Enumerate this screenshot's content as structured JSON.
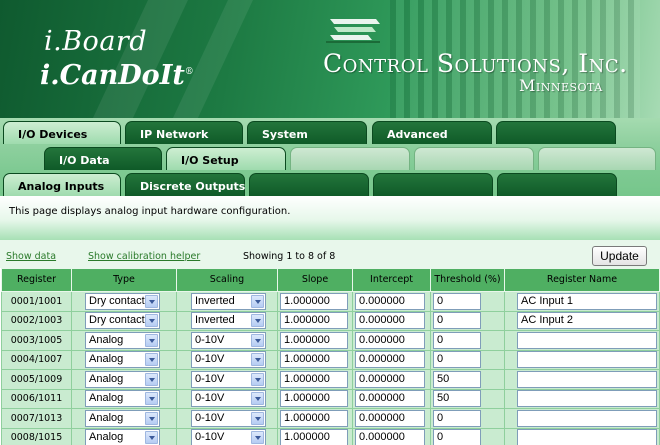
{
  "brand": {
    "line1": "i.Board",
    "line2": "i.CanDoIt",
    "trademark": "®",
    "company": "Control Solutions, Inc.",
    "state": "Minnesota"
  },
  "tabs_level1": [
    "I/O Devices",
    "IP Network",
    "System",
    "Advanced"
  ],
  "tabs_level2": [
    "I/O Data",
    "I/O Setup"
  ],
  "tabs_level3": [
    "Analog Inputs",
    "Discrete Outputs"
  ],
  "description": "This page displays analog input hardware configuration.",
  "toolbar": {
    "show_data": "Show data",
    "show_calibration": "Show calibration helper",
    "showing": "Showing 1 to 8 of 8",
    "update": "Update"
  },
  "table": {
    "headers": [
      "Register",
      "Type",
      "Scaling",
      "Slope",
      "Intercept",
      "Threshold (%)",
      "Register Name"
    ],
    "rows": [
      {
        "register": "0001/1001",
        "type": "Dry contact",
        "scaling": "Inverted",
        "slope": "1.000000",
        "intercept": "0.000000",
        "threshold": "0",
        "name": "AC Input 1"
      },
      {
        "register": "0002/1003",
        "type": "Dry contact",
        "scaling": "Inverted",
        "slope": "1.000000",
        "intercept": "0.000000",
        "threshold": "0",
        "name": "AC Input 2"
      },
      {
        "register": "0003/1005",
        "type": "Analog",
        "scaling": "0-10V",
        "slope": "1.000000",
        "intercept": "0.000000",
        "threshold": "0",
        "name": ""
      },
      {
        "register": "0004/1007",
        "type": "Analog",
        "scaling": "0-10V",
        "slope": "1.000000",
        "intercept": "0.000000",
        "threshold": "0",
        "name": ""
      },
      {
        "register": "0005/1009",
        "type": "Analog",
        "scaling": "0-10V",
        "slope": "1.000000",
        "intercept": "0.000000",
        "threshold": "50",
        "name": ""
      },
      {
        "register": "0006/1011",
        "type": "Analog",
        "scaling": "0-10V",
        "slope": "1.000000",
        "intercept": "0.000000",
        "threshold": "50",
        "name": ""
      },
      {
        "register": "0007/1013",
        "type": "Analog",
        "scaling": "0-10V",
        "slope": "1.000000",
        "intercept": "0.000000",
        "threshold": "0",
        "name": ""
      },
      {
        "register": "0008/1015",
        "type": "Analog",
        "scaling": "0-10V",
        "slope": "1.000000",
        "intercept": "0.000000",
        "threshold": "0",
        "name": ""
      }
    ]
  }
}
